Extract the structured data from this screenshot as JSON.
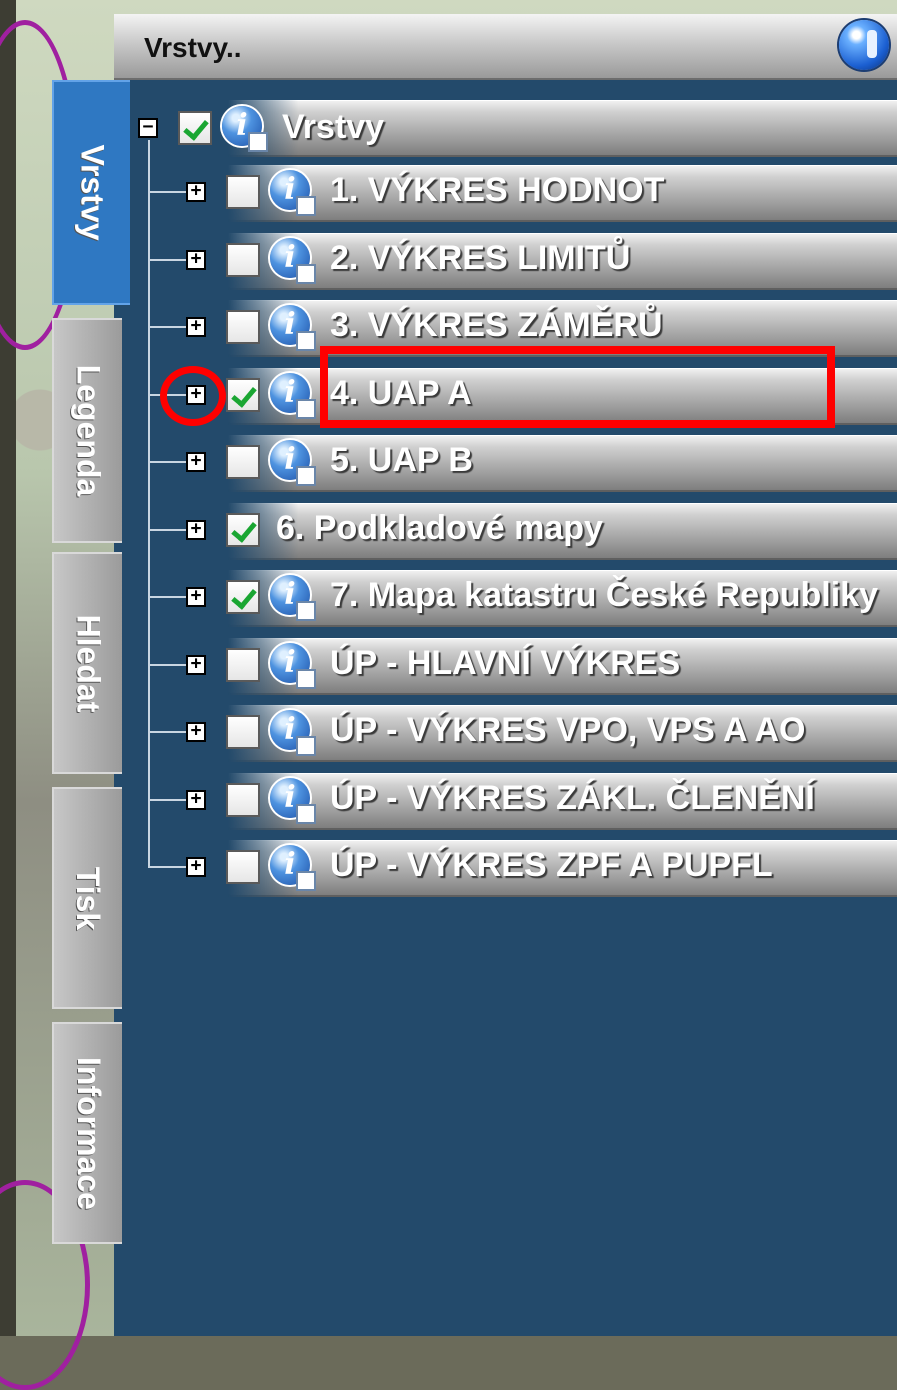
{
  "panel": {
    "title": "Vrstvy..",
    "globe_icon": "globe-icon"
  },
  "tabs": [
    {
      "label": "Vrstvy",
      "active": true
    },
    {
      "label": "Legenda",
      "active": false
    },
    {
      "label": "Hledat",
      "active": false
    },
    {
      "label": "Tisk",
      "active": false
    },
    {
      "label": "Informace",
      "active": false
    }
  ],
  "tree": {
    "root": {
      "label": "Vrstvy",
      "checked": true,
      "expander": "−",
      "icon": "info-icon"
    },
    "items": [
      {
        "label": "1. VÝKRES HODNOT",
        "checked": false,
        "expander": "+",
        "has_info": true
      },
      {
        "label": "2. VÝKRES LIMITŮ",
        "checked": false,
        "expander": "+",
        "has_info": true
      },
      {
        "label": "3. VÝKRES ZÁMĚRŮ",
        "checked": false,
        "expander": "+",
        "has_info": true
      },
      {
        "label": "4. UAP A",
        "checked": true,
        "expander": "+",
        "has_info": true,
        "highlighted": true
      },
      {
        "label": "5. UAP B",
        "checked": false,
        "expander": "+",
        "has_info": true
      },
      {
        "label": "6. Podkladové mapy",
        "checked": true,
        "expander": "+",
        "has_info": false
      },
      {
        "label": "7. Mapa katastru České Republiky",
        "checked": true,
        "expander": "+",
        "has_info": true
      },
      {
        "label": "ÚP - HLAVNÍ VÝKRES",
        "checked": false,
        "expander": "+",
        "has_info": true
      },
      {
        "label": "ÚP - VÝKRES VPO, VPS A AO",
        "checked": false,
        "expander": "+",
        "has_info": true
      },
      {
        "label": "ÚP - VÝKRES ZÁKL. ČLENĚNÍ",
        "checked": false,
        "expander": "+",
        "has_info": true
      },
      {
        "label": "ÚP - VÝKRES ZPF A PUPFL",
        "checked": false,
        "expander": "+",
        "has_info": true
      }
    ]
  },
  "annotation": {
    "color": "#ff0000"
  },
  "colors": {
    "panel_bg": "#234a6b",
    "active_tab": "#2f78c2",
    "check": "#1aa632"
  }
}
